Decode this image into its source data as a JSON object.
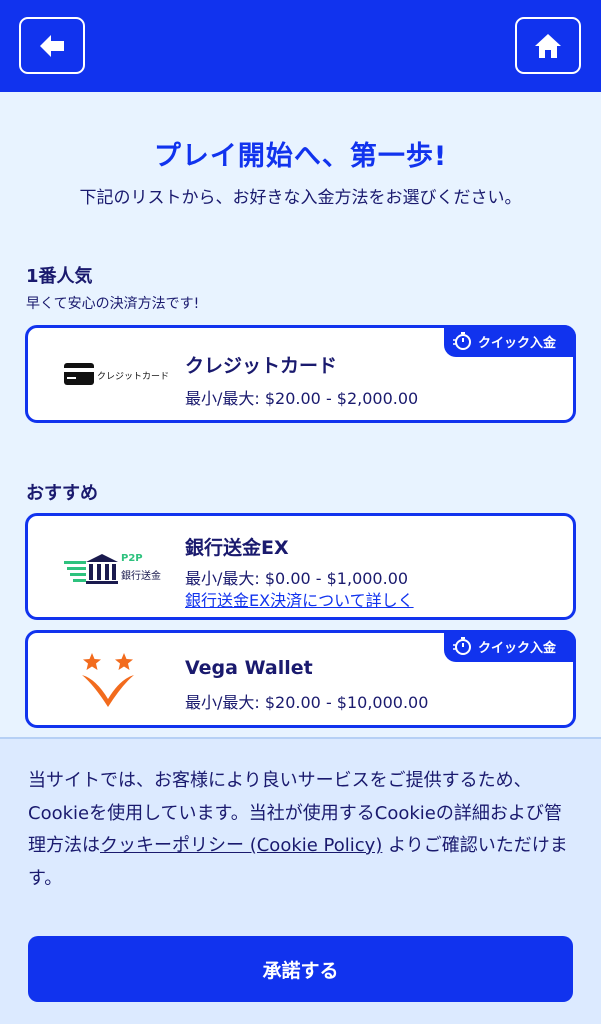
{
  "header": {
    "back_icon": "back-arrow-icon",
    "home_icon": "home-icon"
  },
  "main": {
    "title": "プレイ開始へ、第一歩!",
    "subtitle": "下記のリストから、お好きな入金方法をお選びください。"
  },
  "sections": {
    "popular": {
      "title": "1番人気",
      "subtitle": "早くて安心の決済方法です!"
    },
    "recommended": {
      "title": "おすすめ"
    }
  },
  "methods": [
    {
      "name": "クレジットカード",
      "range": "最小/最大: $20.00 - $2,000.00",
      "logo_text": "クレジットカード",
      "badge": "クイック入金"
    },
    {
      "name": "銀行送金EX",
      "range": "最小/最大: $0.00 - $1,000.00",
      "link": "銀行送金EX決済について詳しく",
      "logo_text_top": "P2P",
      "logo_text_bottom": "銀行送金"
    },
    {
      "name": "Vega Wallet",
      "range": "最小/最大: $20.00 - $10,000.00",
      "badge": "クイック入金"
    }
  ],
  "cookie": {
    "text_before": "当サイトでは、お客様により良いサービスをご提供するため、Cookieを使用しています。当社が使用するCookieの詳細および管理方法は",
    "link": "クッキーポリシー (Cookie Policy)",
    "text_after": " よりご確認いただけます。",
    "accept_label": "承諾する"
  },
  "colors": {
    "brand_blue": "#1133ee",
    "text_navy": "#1a1a6e",
    "page_bg": "#e8f3ff",
    "vega_orange": "#f26b1d"
  }
}
